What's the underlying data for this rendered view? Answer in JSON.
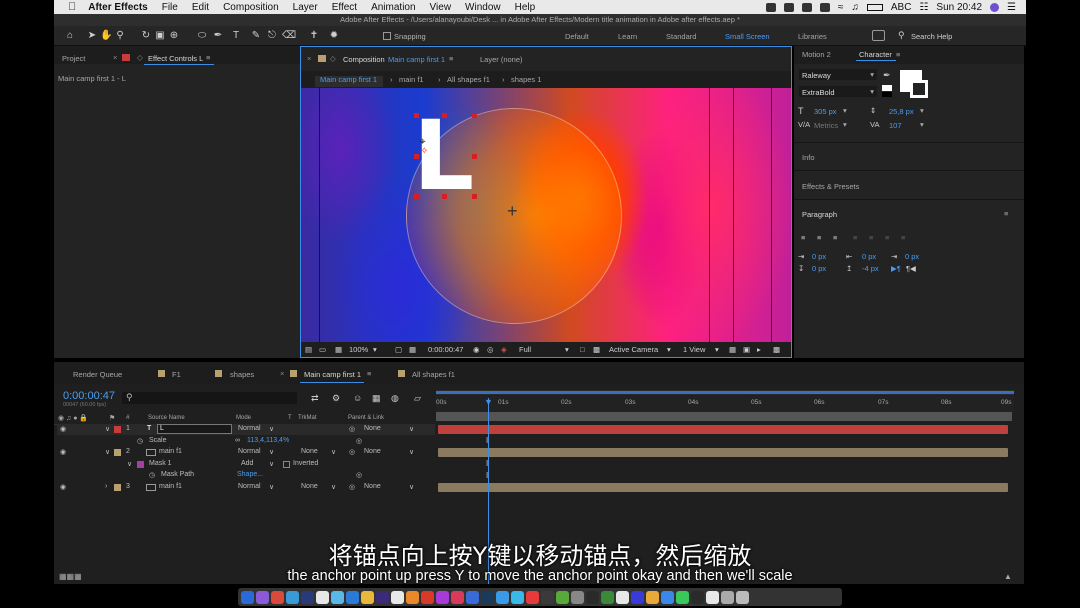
{
  "menubar": {
    "app": "After Effects",
    "items": [
      "File",
      "Edit",
      "Composition",
      "Layer",
      "Effect",
      "Animation",
      "View",
      "Window",
      "Help"
    ],
    "input_source": "ABC",
    "clock": "Sun 20:42"
  },
  "window_title": "Adobe After Effects - /Users/alanayoubi/Desk ... in Adobe After Effects/Modern title animation in Adobe after effects.aep *",
  "toolbar": {
    "snapping_label": "Snapping",
    "workspaces": [
      "Default",
      "Learn",
      "Standard",
      "Small Screen",
      "Libraries"
    ],
    "active_workspace": "Small Screen",
    "search_help": "Search Help"
  },
  "left_panel": {
    "tab_project": "Project",
    "tab_effect_controls": "Effect Controls L",
    "breadcrumb": "Main camp first 1 - L"
  },
  "comp_panel": {
    "tab_label": "Composition",
    "tab_comp_name": "Main camp first 1",
    "layer_tab": "Layer (none)",
    "breadcrumbs": [
      "Main camp first 1",
      "main f1",
      "All shapes f1",
      "shapes 1"
    ],
    "letter": "L",
    "viewbar": {
      "zoom": "100%",
      "timecode": "0:00:00:47",
      "resolution": "Full",
      "camera": "Active Camera",
      "views": "1 View"
    }
  },
  "right_panel": {
    "tab_motion": "Motion 2",
    "tab_character": "Character",
    "font_family": "Raleway",
    "font_style": "ExtraBold",
    "font_size": "305 px",
    "leading": "25,8 px",
    "kerning": "Metrics",
    "tracking": "107",
    "info": "Info",
    "effects_presets": "Effects & Presets",
    "paragraph": "Paragraph",
    "indent_left": "0 px",
    "indent_right": "0 px",
    "indent_first": "0 px",
    "space_before": "0 px",
    "space_after": "-4 px"
  },
  "timeline": {
    "tabs": [
      "Render Queue",
      "F1",
      "shapes",
      "Main camp first 1",
      "All shapes f1"
    ],
    "active_tab": "Main camp first 1",
    "current_time": "0:00:00:47",
    "fps_note": "00047 (60.00 fps)",
    "columns": {
      "num": "#",
      "source_name": "Source Name",
      "mode": "Mode",
      "t": "T",
      "trkmat": "TrkMat",
      "parent": "Parent & Link"
    },
    "ruler": [
      "00s",
      "01s",
      "02s",
      "03s",
      "04s",
      "05s",
      "06s",
      "07s",
      "08s",
      "09s"
    ],
    "rows": [
      {
        "num": "1",
        "name": "L",
        "mode": "Normal",
        "trkmat": "",
        "parent": "None"
      },
      {
        "prop": "Scale",
        "value": "113,4,113,4%"
      },
      {
        "num": "2",
        "name": "main f1",
        "mode": "Normal",
        "trkmat": "None",
        "parent": "None"
      },
      {
        "prop": "Mask 1",
        "mode": "Add",
        "extra": "Inverted"
      },
      {
        "prop": "Mask Path",
        "value": "Shape..."
      },
      {
        "num": "3",
        "name": "main f1",
        "mode": "Normal",
        "trkmat": "None",
        "parent": "None"
      }
    ]
  },
  "subtitles": {
    "cn": "将锚点向上按Y键以移动锚点，然后缩放",
    "en": "the anchor point up press Y to move the anchor point okay and then we'll scale"
  },
  "colors": {
    "accent_blue": "#4a9cf0",
    "layer1_bar": "#c0403c",
    "layer_bar": "#8a7a60",
    "label_red": "#c83c3c",
    "label_tan": "#b8a070"
  }
}
